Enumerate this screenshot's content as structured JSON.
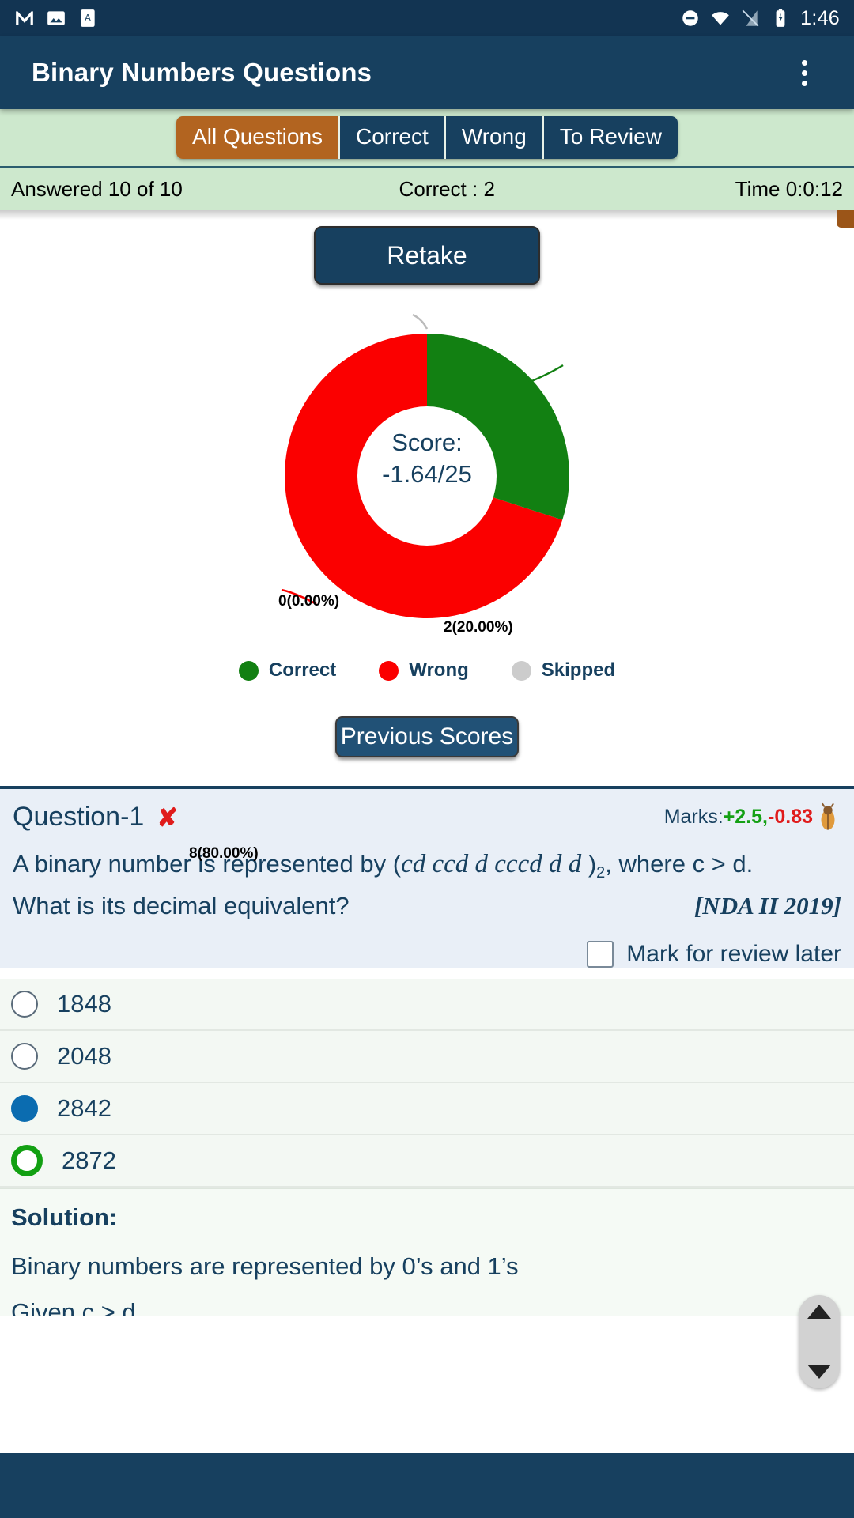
{
  "statusbar": {
    "time": "1:46",
    "icons": [
      "gmail-icon",
      "photos-icon",
      "text-app-icon",
      "dnd-icon",
      "wifi-icon",
      "signal-icon",
      "battery-icon"
    ]
  },
  "appbar": {
    "title": "Binary Numbers Questions",
    "overflow_label": "More options"
  },
  "tabs": [
    {
      "label": "All Questions",
      "active": true
    },
    {
      "label": "Correct",
      "active": false
    },
    {
      "label": "Wrong",
      "active": false
    },
    {
      "label": "To Review",
      "active": false
    }
  ],
  "stats": {
    "answered": "Answered 10 of 10",
    "correct": "Correct : 2",
    "time": "Time 0:0:12"
  },
  "result": {
    "retake_label": "Retake",
    "previous_scores_label": "Previous Scores",
    "score_line1": "Score:",
    "score_line2": "-1.64/25"
  },
  "chart_data": {
    "type": "pie",
    "title": "",
    "subtype": "donut",
    "categories": [
      "Correct",
      "Wrong",
      "Skipped"
    ],
    "values": [
      2,
      8,
      0
    ],
    "percentages": [
      20.0,
      80.0,
      0.0
    ],
    "colors": [
      "#128012",
      "#fb0000",
      "#cccccc"
    ],
    "labels": [
      "2(20.00%)",
      "8(80.00%)",
      "0(0.00%)"
    ],
    "center_text": [
      "Score:",
      "-1.64/25"
    ],
    "legend": [
      {
        "label": "Correct",
        "color": "#128012"
      },
      {
        "label": "Wrong",
        "color": "#fb0000"
      },
      {
        "label": "Skipped",
        "color": "#cccccc"
      }
    ],
    "legend_position": "bottom",
    "start_angle_deg": 0,
    "total": 10
  },
  "question": {
    "heading": "Question-1",
    "result_mark": "✘",
    "marks_prefix": "Marks:",
    "marks_positive": "+2.5,",
    "marks_negative": "-0.83",
    "report_icon": "bug-icon",
    "text_part1": "A binary number is represented by (",
    "text_math": "cd ccd d cccd d d",
    "text_part2": " )",
    "text_sub": "2",
    "text_part3": ", where c > d.",
    "text_line2": "What is its decimal equivalent?",
    "source": "[NDA II 2019]",
    "review_label": "Mark for review later"
  },
  "options": [
    {
      "text": "1848",
      "state": "none"
    },
    {
      "text": "2048",
      "state": "none"
    },
    {
      "text": "2842",
      "state": "selected"
    },
    {
      "text": "2872",
      "state": "correct"
    }
  ],
  "solution": {
    "title": "Solution:",
    "line1": "Binary numbers are represented by 0’s and 1’s",
    "line2": "Given  c > d"
  },
  "colors": {
    "app_bar": "#17405f",
    "accent_orange": "#b26420",
    "tab_bg": "#cde8cd",
    "correct_green": "#128012",
    "wrong_red": "#fb0000",
    "skipped_grey": "#cccccc",
    "selected_blue": "#0b6cb0"
  }
}
